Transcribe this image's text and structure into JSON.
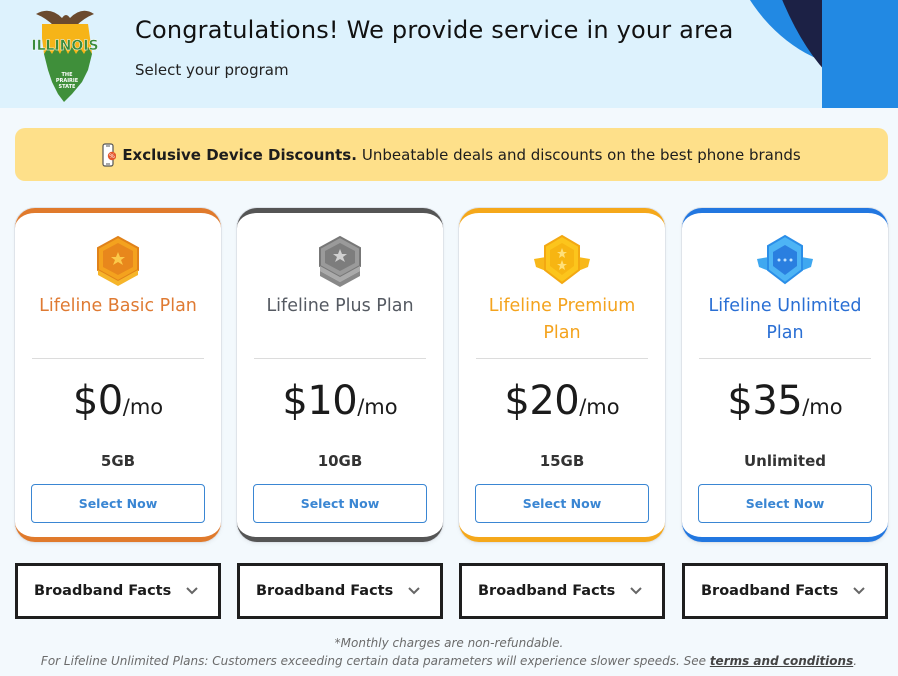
{
  "header": {
    "logo": {
      "state": "ILLINOIS",
      "tagline": [
        "THE",
        "PRAIRIE",
        "STATE"
      ],
      "colors": {
        "gold": "#f6b418",
        "green": "#3f8f3a",
        "eagle": "#6b4a2e"
      }
    },
    "title": "Congratulations! We provide service in your area",
    "subtitle": "Select your program"
  },
  "promo": {
    "icon": "phone-discount-icon",
    "bold_text": "Exclusive Device Discounts.",
    "text": "Unbeatable deals and discounts on the best phone brands"
  },
  "plans": [
    {
      "name": "Lifeline Basic Plan",
      "badge": "bronze-badge-icon",
      "price": "$0",
      "period": "/mo",
      "data": "5GB",
      "button": "Select Now",
      "accent": "#e07a2c"
    },
    {
      "name": "Lifeline Plus Plan",
      "badge": "silver-badge-icon",
      "price": "$10",
      "period": "/mo",
      "data": "10GB",
      "button": "Select Now",
      "accent": "#555555"
    },
    {
      "name": "Lifeline Premium Plan",
      "badge": "gold-badge-icon",
      "price": "$20",
      "period": "/mo",
      "data": "15GB",
      "button": "Select Now",
      "accent": "#f5a81b"
    },
    {
      "name": "Lifeline Unlimited Plan",
      "badge": "diamond-badge-icon",
      "price": "$35",
      "period": "/mo",
      "data": "Unlimited",
      "button": "Select Now",
      "accent": "#2277e0"
    }
  ],
  "broadband_facts": [
    {
      "label": "Broadband Facts",
      "icon": "chevron-down-icon"
    },
    {
      "label": "Broadband Facts",
      "icon": "chevron-down-icon"
    },
    {
      "label": "Broadband Facts",
      "icon": "chevron-down-icon"
    },
    {
      "label": "Broadband Facts",
      "icon": "chevron-down-icon"
    }
  ],
  "footer": {
    "note1": "*Monthly charges are non-refundable.",
    "note2": "For Lifeline Unlimited Plans: Customers exceeding certain data parameters will experience slower speeds. See ",
    "link": "terms and conditions",
    "note2_end": "."
  }
}
